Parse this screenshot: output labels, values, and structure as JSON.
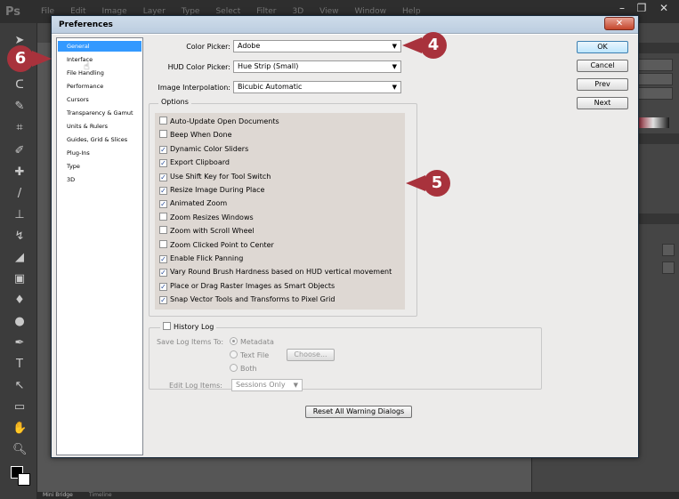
{
  "app": {
    "logo": "Ps",
    "menu": [
      "File",
      "Edit",
      "Image",
      "Layer",
      "Type",
      "Select",
      "Filter",
      "3D",
      "View",
      "Window",
      "Help"
    ],
    "bottom_tabs": [
      "Mini Bridge",
      "Timeline"
    ]
  },
  "dialog": {
    "title": "Preferences",
    "close_glyph": "✕",
    "categories": [
      "General",
      "Interface",
      "File Handling",
      "Performance",
      "Cursors",
      "Transparency & Gamut",
      "Units & Rulers",
      "Guides, Grid & Slices",
      "Plug-Ins",
      "Type",
      "3D"
    ],
    "selected_category": "General",
    "fields": {
      "color_picker": {
        "label": "Color Picker:",
        "value": "Adobe"
      },
      "hud_color_picker": {
        "label": "HUD Color Picker:",
        "value": "Hue Strip (Small)"
      },
      "image_interpolation": {
        "label": "Image Interpolation:",
        "value": "Bicubic Automatic"
      }
    },
    "options_title": "Options",
    "options": [
      {
        "label": "Auto-Update Open Documents",
        "checked": false
      },
      {
        "label": "Beep When Done",
        "checked": false
      },
      {
        "label": "Dynamic Color Sliders",
        "checked": true
      },
      {
        "label": "Export Clipboard",
        "checked": true
      },
      {
        "label": "Use Shift Key for Tool Switch",
        "checked": true
      },
      {
        "label": "Resize Image During Place",
        "checked": true
      },
      {
        "label": "Animated Zoom",
        "checked": true
      },
      {
        "label": "Zoom Resizes Windows",
        "checked": false
      },
      {
        "label": "Zoom with Scroll Wheel",
        "checked": false
      },
      {
        "label": "Zoom Clicked Point to Center",
        "checked": false
      },
      {
        "label": "Enable Flick Panning",
        "checked": true
      },
      {
        "label": "Vary Round Brush Hardness based on HUD vertical movement",
        "checked": true
      },
      {
        "label": "Place or Drag Raster Images as Smart Objects",
        "checked": true
      },
      {
        "label": "Snap Vector Tools and Transforms to Pixel Grid",
        "checked": true
      }
    ],
    "history": {
      "label": "History Log",
      "checked": false,
      "save_label": "Save Log Items To:",
      "radios": [
        {
          "label": "Metadata",
          "selected": true
        },
        {
          "label": "Text File",
          "selected": false
        },
        {
          "label": "Both",
          "selected": false
        }
      ],
      "choose_label": "Choose...",
      "edit_label": "Edit Log Items:",
      "edit_value": "Sessions Only"
    },
    "reset_label": "Reset All Warning Dialogs",
    "buttons": {
      "ok": "OK",
      "cancel": "Cancel",
      "prev": "Prev",
      "next": "Next"
    }
  },
  "callouts": {
    "c4": "4",
    "c5": "5",
    "c6": "6"
  },
  "colors": {
    "callout": "#a8323c",
    "selection": "#3399ff"
  }
}
